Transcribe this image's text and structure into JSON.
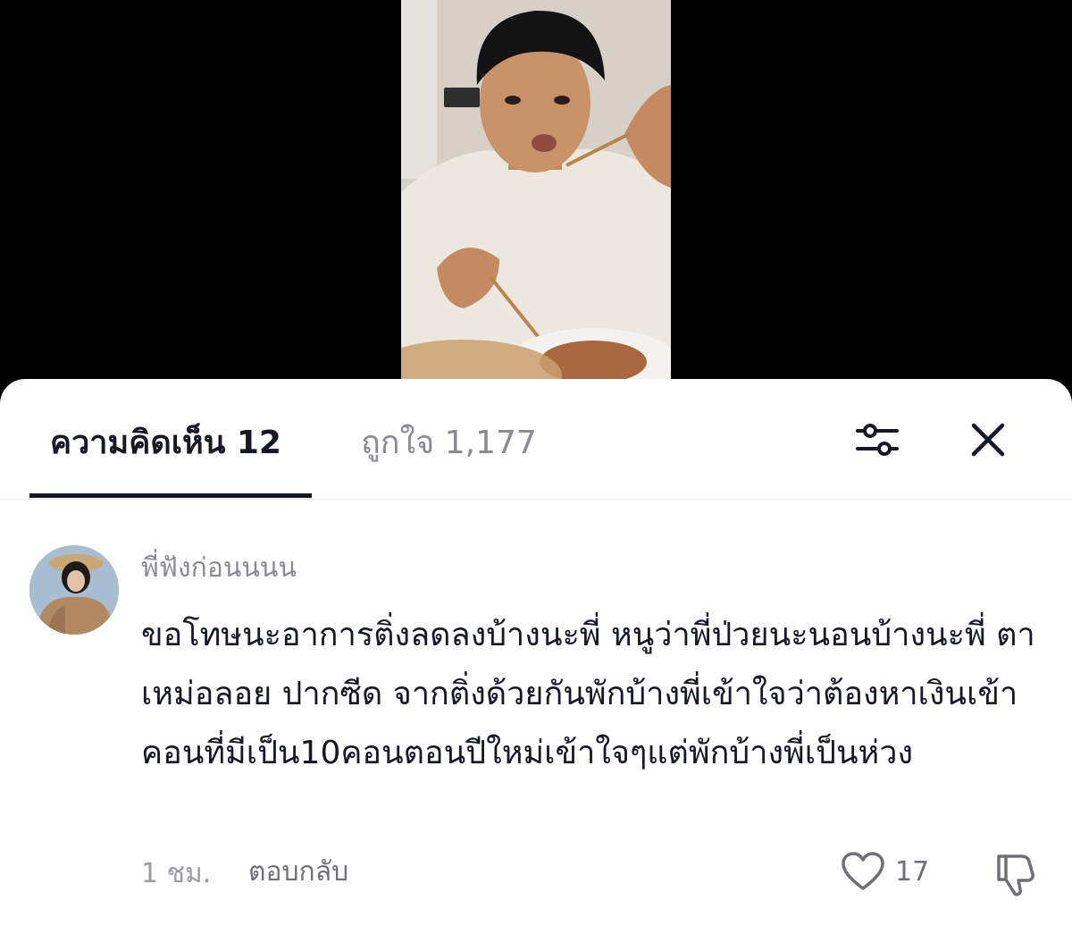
{
  "video": {
    "background": "#000000"
  },
  "tabs": {
    "comments_label": "ความคิดเห็น 12",
    "likes_label": "ถูกใจ 1,177"
  },
  "toolbar": {
    "filter_icon": "sliders-icon",
    "close_icon": "close-icon"
  },
  "comment": {
    "username": "พี่ฟังก่อนนนน",
    "text": "ขอโทษนะอาการติ่งลดลงบ้างนะพี่ หนูว่าพี่ป่วยนะนอนบ้างนะพี่ ตาเหม่อลอย ปากซีด จากติ่งด้วยกันพักบ้างพี่เข้าใจว่าต้องหาเงินเข้าคอนที่มีเป็น10คอนตอนปีใหม่เข้าใจๆแต่พักบ้างพี่เป็นห่วง",
    "time": "1 ชม.",
    "reply_label": "ตอบกลับ",
    "like_count": "17",
    "like_icon": "heart-icon",
    "dislike_icon": "thumbs-down-icon"
  },
  "colors": {
    "text_primary": "#161823",
    "text_secondary": "#8a8b91",
    "sheet_background": "#ffffff"
  }
}
